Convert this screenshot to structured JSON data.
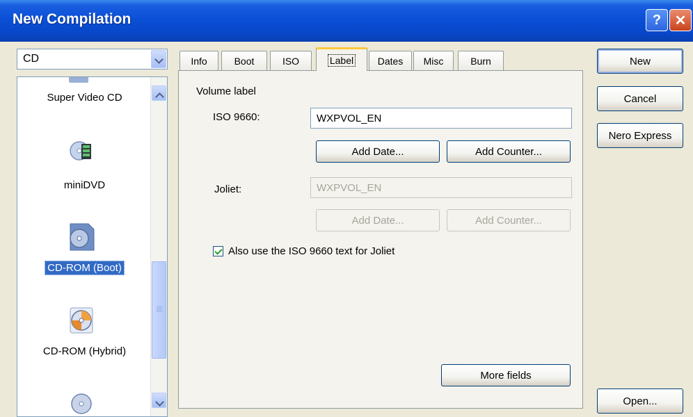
{
  "window": {
    "title": "New Compilation"
  },
  "disc_type": {
    "selected": "CD"
  },
  "compilations": [
    {
      "label": "Super Video CD",
      "icon": "super-video-cd-icon"
    },
    {
      "label": "miniDVD",
      "icon": "minidvd-icon"
    },
    {
      "label": "CD-ROM (Boot)",
      "icon": "cd-rom-boot-icon",
      "selected": true
    },
    {
      "label": "CD-ROM (Hybrid)",
      "icon": "cd-rom-hybrid-icon"
    }
  ],
  "tabs": [
    "Info",
    "Boot",
    "ISO",
    "Label",
    "Dates",
    "Misc",
    "Burn"
  ],
  "active_tab": "Label",
  "label_tab": {
    "volume_label": "Volume label",
    "iso_9660_label": "ISO 9660:",
    "iso_9660_value": "WXPVOL_EN",
    "add_date": "Add Date...",
    "add_counter": "Add Counter...",
    "joliet_label": "Joliet:",
    "joliet_value": "WXPVOL_EN",
    "joliet_add_date": "Add Date...",
    "joliet_add_counter": "Add Counter...",
    "also_use_checkbox": "Also use the ISO 9660 text for Joliet",
    "also_use_checked": true,
    "more_fields": "More fields"
  },
  "buttons": {
    "new": "New",
    "cancel": "Cancel",
    "nero_express": "Nero Express",
    "open": "Open..."
  }
}
